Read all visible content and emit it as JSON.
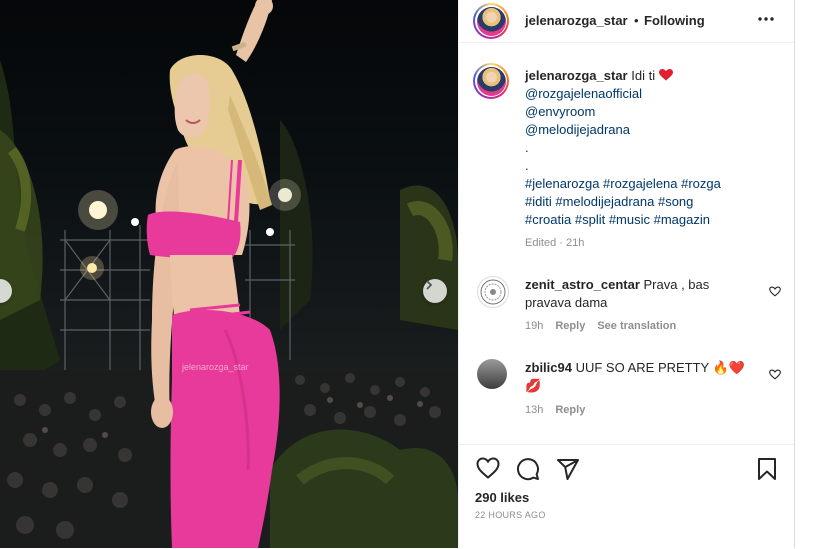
{
  "post": {
    "username": "jelenarozga_star",
    "separator": "•",
    "follow_status": "Following",
    "more_label": "•••",
    "watermark": "jelenarozga_star"
  },
  "caption": {
    "username": "jelenarozga_star",
    "text": "Idi ti",
    "mentions": [
      "@rozgajelenaofficial",
      "@envyroom",
      "@melodijejadrana"
    ],
    "dots": [
      ".",
      "."
    ],
    "hashtag_lines": [
      "#jelenarozga #rozgajelena #rozga",
      "#iditi #melodijejadrana #song",
      "#croatia #split #music #magazin"
    ],
    "edited": "Edited",
    "age": "21h"
  },
  "comments": [
    {
      "username": "zenit_astro_centar",
      "text": "Prava , bas pravava dama",
      "age": "19h",
      "reply": "Reply",
      "translate": "See translation"
    },
    {
      "username": "zbilic94",
      "text": "UUF SO ARE PRETTY 🔥❤️💋",
      "age": "13h",
      "reply": "Reply"
    }
  ],
  "engagement": {
    "likes": "290 likes",
    "timestamp": "22 HOURS AGO"
  },
  "icons": {
    "like": "heart-icon",
    "comment": "comment-icon",
    "share": "send-icon",
    "save": "bookmark-icon",
    "prev": "chevron-left-icon",
    "next": "chevron-right-icon"
  },
  "colors": {
    "dress": "#e83a9a",
    "link": "#00376b",
    "muted": "#8e8e8e"
  }
}
